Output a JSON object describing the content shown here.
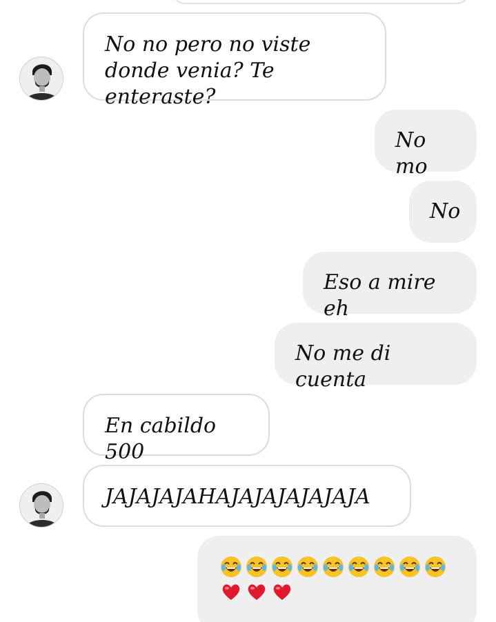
{
  "messages": [
    {
      "side": "in",
      "text": "No no pero no viste donde venia? Te enteraste?"
    },
    {
      "side": "out",
      "text": "No mo"
    },
    {
      "side": "out",
      "text": "No"
    },
    {
      "side": "out",
      "text": "Eso a mire eh"
    },
    {
      "side": "out",
      "text": "No me di cuenta"
    },
    {
      "side": "in",
      "text": "En cabildo 500"
    },
    {
      "side": "in",
      "text": "JAJAJAJAHAJAJAJAJAJAJA"
    },
    {
      "side": "out",
      "emoji": [
        "face-with-tears-of-joy",
        "face-with-tears-of-joy",
        "face-with-tears-of-joy",
        "face-with-tears-of-joy",
        "face-with-tears-of-joy",
        "face-with-tears-of-joy",
        "face-with-tears-of-joy",
        "face-with-tears-of-joy",
        "face-with-tears-of-joy",
        "red-heart",
        "red-heart",
        "red-heart"
      ]
    }
  ],
  "colors": {
    "incoming_border": "#dcdcdc",
    "outgoing_bg": "#efefef",
    "text": "#111111",
    "heart": "#e0192f",
    "emoji_face": "#f7c325"
  }
}
